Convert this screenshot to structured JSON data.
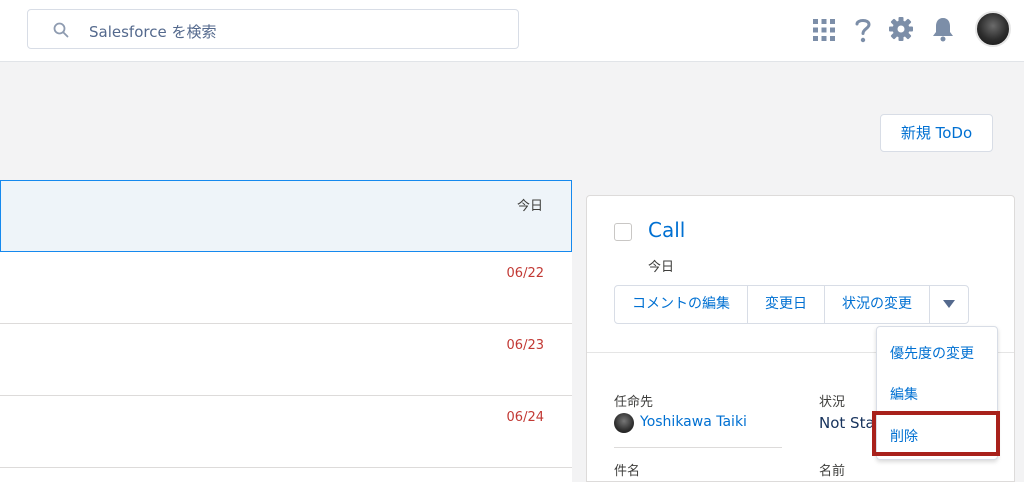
{
  "header": {
    "search_placeholder": "Salesforce を検索",
    "icons": [
      "search-icon",
      "app-launcher-icon",
      "help-icon",
      "setup-gear-icon",
      "notifications-bell-icon",
      "user-avatar"
    ]
  },
  "toolbar": {
    "new_todo_label": "新規 ToDo"
  },
  "list": {
    "rows": [
      {
        "date": "今日",
        "overdue": false
      },
      {
        "date": "06/22",
        "overdue": true
      },
      {
        "date": "06/23",
        "overdue": true
      },
      {
        "date": "06/24",
        "overdue": true
      }
    ]
  },
  "detail": {
    "title": "Call",
    "due": "今日",
    "actions": [
      "コメントの編集",
      "変更日",
      "状況の変更"
    ],
    "fields": {
      "assigned_label": "任命先",
      "assigned_value": "Yoshikawa Taiki",
      "status_label": "状況",
      "status_value": "Not Sta",
      "subject_label": "件名",
      "name_label": "名前"
    }
  },
  "menu": {
    "items": [
      "優先度の変更",
      "編集",
      "削除"
    ],
    "highlighted_item": "削除"
  },
  "colors": {
    "link_blue": "#0070d2",
    "overdue_red": "#c23934",
    "highlight_border": "#a8211b",
    "selected_row_bg": "#eef4f9"
  }
}
